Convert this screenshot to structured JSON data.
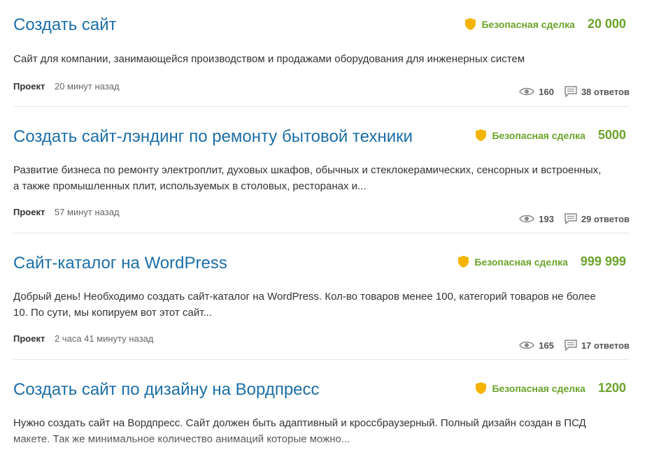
{
  "colors": {
    "title": "#1c6fa8",
    "deal": "#6aa329",
    "shield": "#f4b400"
  },
  "projects": [
    {
      "title": "Создать сайт",
      "deal_label": "Безопасная сделка",
      "price": "20 000",
      "currency": "",
      "description": "Сайт для компании, занимающейся производством и продажами оборудования для инженерных систем",
      "kind": "Проект",
      "time": "20 минут назад",
      "views": "160",
      "answers": "38 ответов"
    },
    {
      "title": "Создать сайт-лэндинг по ремонту бытовой техники",
      "deal_label": "Безопасная сделка",
      "price": "5000",
      "currency": "",
      "description": "Развитие бизнеса по ремонту электроплит, духовых шкафов, обычных и стеклокерамических, сенсорных и встроенных, а также промышленных плит, используемых в столовых, ресторанах и...",
      "kind": "Проект",
      "time": "57 минут назад",
      "views": "193",
      "answers": "29 ответов"
    },
    {
      "title": "Сайт-каталог на WordPress",
      "deal_label": "Безопасная сделка",
      "price": "999 999",
      "currency": "",
      "description": "Добрый день! Необходимо создать сайт-каталог на WordPress. Кол-во товаров менее 100, категорий товаров не более 10. По сути, мы копируем вот этот сайт...",
      "kind": "Проект",
      "time": "2 часа 41 минуту назад",
      "views": "165",
      "answers": "17 ответов"
    },
    {
      "title": "Создать сайт по дизайну на Вордпресс",
      "deal_label": "Безопасная сделка",
      "price": "1200",
      "currency": "",
      "description": "Нужно создать сайт на Вордпресс. Сайт должен быть адаптивный и кроссбраузерный. Полный дизайн создан в ПСД макете.  Так же минимальное количество анимаций которые можно..."
    }
  ]
}
